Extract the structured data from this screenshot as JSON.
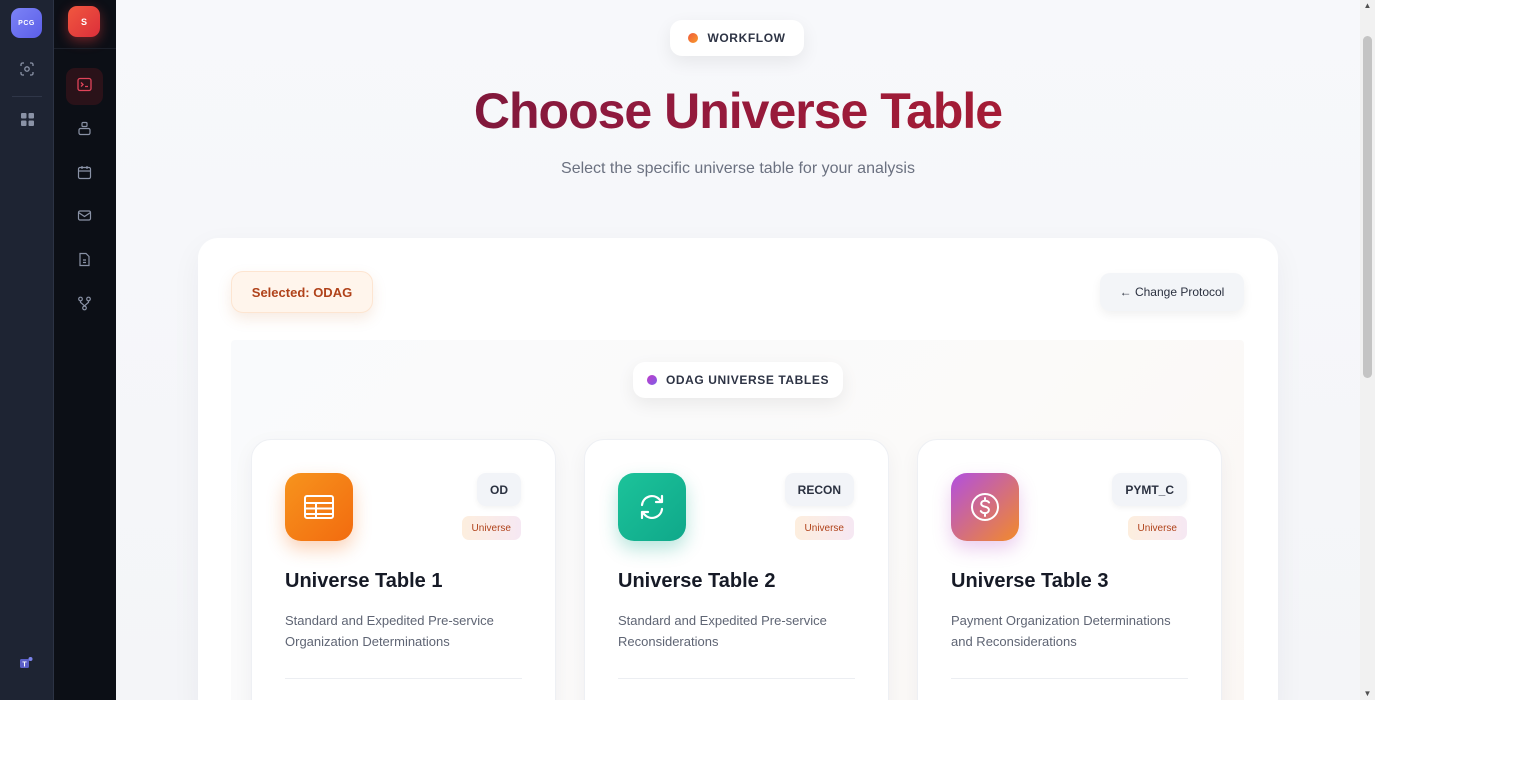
{
  "rail1": {
    "logo_text": "PCG",
    "icons": [
      "focus-icon",
      "grid-icon",
      "teams-icon"
    ]
  },
  "rail2": {
    "logo_text": "S",
    "nav_icons": [
      "terminal-icon",
      "user-icon",
      "calendar-icon",
      "mail-icon",
      "document-icon",
      "network-icon"
    ]
  },
  "header": {
    "badge": "WORKFLOW",
    "title": "Choose Universe Table",
    "subtitle": "Select the specific universe table for your analysis"
  },
  "panel": {
    "selected_label": "Selected: ODAG",
    "change_button": "← Change Protocol",
    "section_label": "ODAG UNIVERSE TABLES"
  },
  "cards": [
    {
      "code": "OD",
      "tag": "Universe",
      "title": "Universe Table 1",
      "description": "Standard and Expedited Pre-service Organization Determinations",
      "icon": "table-icon",
      "color": "#f5820f"
    },
    {
      "code": "RECON",
      "tag": "Universe",
      "title": "Universe Table 2",
      "description": "Standard and Expedited Pre-service Reconsiderations",
      "icon": "refresh-icon",
      "color": "#14b894"
    },
    {
      "code": "PYMT_C",
      "tag": "Universe",
      "title": "Universe Table 3",
      "description": "Payment Organization Determinations and Reconsiderations",
      "icon": "dollar-icon",
      "color": "#b85ad9"
    }
  ]
}
